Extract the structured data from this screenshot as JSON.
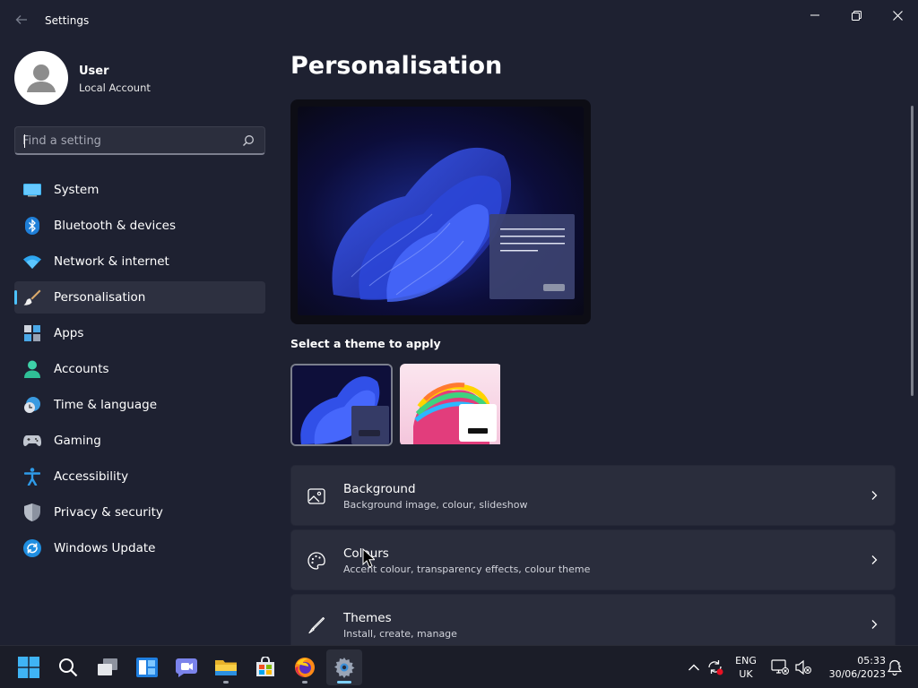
{
  "window": {
    "title": "Settings"
  },
  "profile": {
    "name": "User",
    "account_type": "Local Account"
  },
  "search": {
    "placeholder": "Find a setting"
  },
  "nav": [
    {
      "label": "System",
      "icon": "system-icon"
    },
    {
      "label": "Bluetooth & devices",
      "icon": "bluetooth-icon"
    },
    {
      "label": "Network & internet",
      "icon": "wifi-icon"
    },
    {
      "label": "Personalisation",
      "icon": "brush-icon",
      "active": true
    },
    {
      "label": "Apps",
      "icon": "apps-icon"
    },
    {
      "label": "Accounts",
      "icon": "accounts-icon"
    },
    {
      "label": "Time & language",
      "icon": "time-language-icon"
    },
    {
      "label": "Gaming",
      "icon": "gamepad-icon"
    },
    {
      "label": "Accessibility",
      "icon": "accessibility-icon"
    },
    {
      "label": "Privacy & security",
      "icon": "shield-icon"
    },
    {
      "label": "Windows Update",
      "icon": "windows-update-icon"
    }
  ],
  "main": {
    "title": "Personalisation",
    "themes_label": "Select a theme to apply",
    "themes": [
      {
        "name": "dark-bloom-theme",
        "selected": true
      },
      {
        "name": "glow-theme",
        "selected": false
      }
    ],
    "cards": [
      {
        "title": "Background",
        "description": "Background image, colour, slideshow",
        "icon": "image-icon"
      },
      {
        "title": "Colours",
        "description": "Accent colour, transparency effects, colour theme",
        "icon": "palette-icon"
      },
      {
        "title": "Themes",
        "description": "Install, create, manage",
        "icon": "pen-icon"
      }
    ]
  },
  "taskbar": {
    "apps": [
      "windows-start-icon",
      "search-icon",
      "task-view-icon",
      "widgets-icon",
      "teams-chat-icon",
      "file-explorer-icon",
      "store-icon",
      "firefox-icon",
      "settings-icon"
    ],
    "language": {
      "line1": "ENG",
      "line2": "UK"
    },
    "clock": {
      "time": "05:33",
      "date": "30/06/2023"
    }
  },
  "colors": {
    "accent": "#4cc2ff",
    "background": "#1e2131",
    "card": "#2a2d3c"
  }
}
